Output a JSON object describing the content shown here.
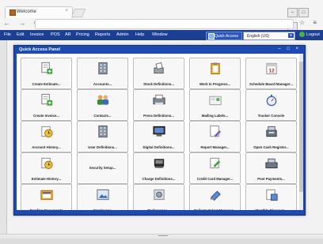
{
  "browser": {
    "tab_title": "Welcome",
    "nav_glyphs": "← → C ⟳",
    "toolbar_glyphs": "☆ ≡"
  },
  "menubar": {
    "items": [
      "File",
      "Edit",
      "Invoice",
      "POS",
      "AR",
      "Pricing",
      "Reports",
      "Admin",
      "Help",
      "Window"
    ],
    "quick_access_label": "Quick Access",
    "language": "English (US)",
    "logout_label": "Logout"
  },
  "panel": {
    "title": "Quick Access Panel",
    "controls": "– □ ×",
    "buttons": [
      {
        "label": "Create Estimate...",
        "icon": "estimate-icon"
      },
      {
        "label": "Accounts...",
        "icon": "accounts-building-icon"
      },
      {
        "label": "Stock Definitions...",
        "icon": "stock-icon"
      },
      {
        "label": "Work In Progress...",
        "icon": "clipboard-icon"
      },
      {
        "label": "Schedule Board Manager...",
        "icon": "calendar-icon"
      },
      {
        "label": "Create Invoice...",
        "icon": "invoice-icon"
      },
      {
        "label": "Contacts...",
        "icon": "contacts-icon"
      },
      {
        "label": "Press Definitions...",
        "icon": "press-icon"
      },
      {
        "label": "Mailing Labels...",
        "icon": "mailing-labels-icon"
      },
      {
        "label": "Tracker Console",
        "icon": "stopwatch-icon"
      },
      {
        "label": "Account History...",
        "icon": "account-history-icon"
      },
      {
        "label": "User Definitions...",
        "icon": "user-definitions-icon"
      },
      {
        "label": "Digital Definitions...",
        "icon": "digital-icon"
      },
      {
        "label": "Report Manager...",
        "icon": "report-icon"
      },
      {
        "label": "Open Cash Register...",
        "icon": "cash-register-icon"
      },
      {
        "label": "Estimate History...",
        "icon": "estimate-history-icon"
      },
      {
        "label": "Security Setup...",
        "icon": ""
      },
      {
        "label": "Charge Definitions...",
        "icon": "charge-icon"
      },
      {
        "label": "Credit Card Manager...",
        "icon": "credit-card-icon"
      },
      {
        "label": "Post Payments...",
        "icon": "post-payments-icon"
      },
      {
        "label": "Pending Documents",
        "icon": "pending-documents-icon"
      },
      {
        "label": "Employees",
        "icon": "employees-icon"
      },
      {
        "label": "Preferences...",
        "icon": "preferences-icon"
      },
      {
        "label": "Delivery Select Manager...",
        "icon": "delivery-icon"
      },
      {
        "label": "Monthly Closeout...",
        "icon": "closeout-icon"
      }
    ]
  },
  "colors": {
    "menubar": "#1c3f94",
    "panel_frame": "#1e49b0"
  }
}
